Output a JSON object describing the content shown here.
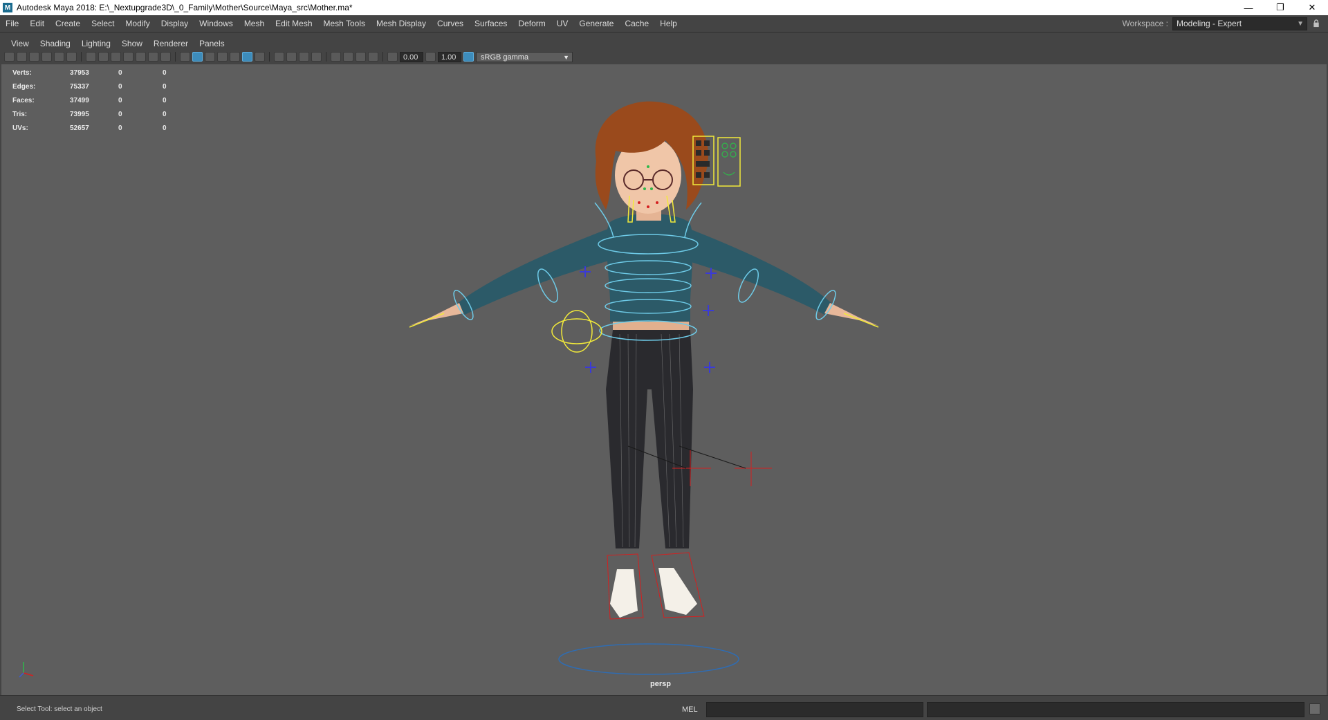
{
  "window": {
    "title": "Autodesk Maya 2018: E:\\_Nextupgrade3D\\_0_Family\\Mother\\Source\\Maya_src\\Mother.ma*",
    "minimize": "—",
    "maximize": "❐",
    "close": "✕"
  },
  "menubar": {
    "items": [
      "File",
      "Edit",
      "Create",
      "Select",
      "Modify",
      "Display",
      "Windows",
      "Mesh",
      "Edit Mesh",
      "Mesh Tools",
      "Mesh Display",
      "Curves",
      "Surfaces",
      "Deform",
      "UV",
      "Generate",
      "Cache",
      "Help"
    ]
  },
  "workspace": {
    "label": "Workspace :",
    "value": "Modeling - Expert"
  },
  "panel_menu": {
    "items": [
      "View",
      "Shading",
      "Lighting",
      "Show",
      "Renderer",
      "Panels"
    ]
  },
  "toolbar": {
    "exposure": "0.00",
    "gamma": "1.00",
    "color_space": "sRGB gamma"
  },
  "hud": {
    "rows": [
      {
        "label": "Verts:",
        "v1": "37953",
        "v2": "0",
        "v3": "0"
      },
      {
        "label": "Edges:",
        "v1": "75337",
        "v2": "0",
        "v3": "0"
      },
      {
        "label": "Faces:",
        "v1": "37499",
        "v2": "0",
        "v3": "0"
      },
      {
        "label": "Tris:",
        "v1": "73995",
        "v2": "0",
        "v3": "0"
      },
      {
        "label": "UVs:",
        "v1": "52657",
        "v2": "0",
        "v3": "0"
      }
    ]
  },
  "viewport": {
    "camera": "persp",
    "background_color": "#5e5e5e"
  },
  "statusbar": {
    "help_line": "Select Tool: select an object",
    "command_label": "MEL"
  },
  "colors": {
    "rig_cyan": "#6ecbe8",
    "rig_yellow": "#f2ea3a",
    "rig_blue": "#3a3ad8",
    "locator_red": "#d42020",
    "sweater": "#2c5a68",
    "pants": "#2a2a2e",
    "hair": "#9a4a1c"
  }
}
